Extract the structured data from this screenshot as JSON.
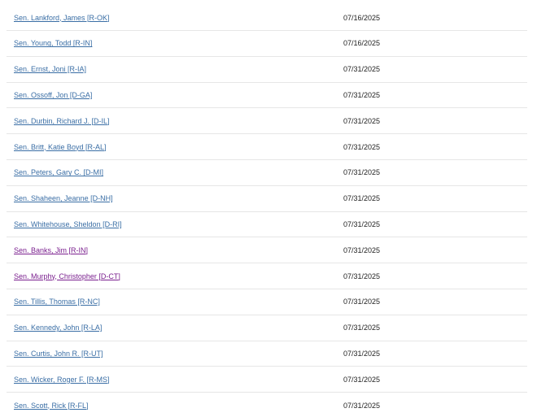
{
  "cosponsors": [
    {
      "name": "Sen. Lankford, James [R-OK]",
      "date": "07/16/2025",
      "visited": false
    },
    {
      "name": "Sen. Young, Todd [R-IN]",
      "date": "07/16/2025",
      "visited": false
    },
    {
      "name": "Sen. Ernst, Joni [R-IA]",
      "date": "07/31/2025",
      "visited": false
    },
    {
      "name": "Sen. Ossoff, Jon [D-GA]",
      "date": "07/31/2025",
      "visited": false
    },
    {
      "name": "Sen. Durbin, Richard J. [D-IL]",
      "date": "07/31/2025",
      "visited": false
    },
    {
      "name": "Sen. Britt, Katie Boyd [R-AL]",
      "date": "07/31/2025",
      "visited": false
    },
    {
      "name": "Sen. Peters, Gary C. [D-MI]",
      "date": "07/31/2025",
      "visited": false
    },
    {
      "name": "Sen. Shaheen, Jeanne [D-NH]",
      "date": "07/31/2025",
      "visited": false
    },
    {
      "name": "Sen. Whitehouse, Sheldon [D-RI]",
      "date": "07/31/2025",
      "visited": false
    },
    {
      "name": "Sen. Banks, Jim [R-IN]",
      "date": "07/31/2025",
      "visited": true
    },
    {
      "name": "Sen. Murphy, Christopher [D-CT]",
      "date": "07/31/2025",
      "visited": true
    },
    {
      "name": "Sen. Tillis, Thomas [R-NC]",
      "date": "07/31/2025",
      "visited": false
    },
    {
      "name": "Sen. Kennedy, John [R-LA]",
      "date": "07/31/2025",
      "visited": false
    },
    {
      "name": "Sen. Curtis, John R. [R-UT]",
      "date": "07/31/2025",
      "visited": false
    },
    {
      "name": "Sen. Wicker, Roger F. [R-MS]",
      "date": "07/31/2025",
      "visited": false
    },
    {
      "name": "Sen. Scott, Rick [R-FL]",
      "date": "07/31/2025",
      "visited": false
    }
  ],
  "colors": {
    "link": "#3a6ea5",
    "link_visited": "#7a1f8e",
    "row_divider": "#e6e6e6",
    "text": "#222222"
  }
}
